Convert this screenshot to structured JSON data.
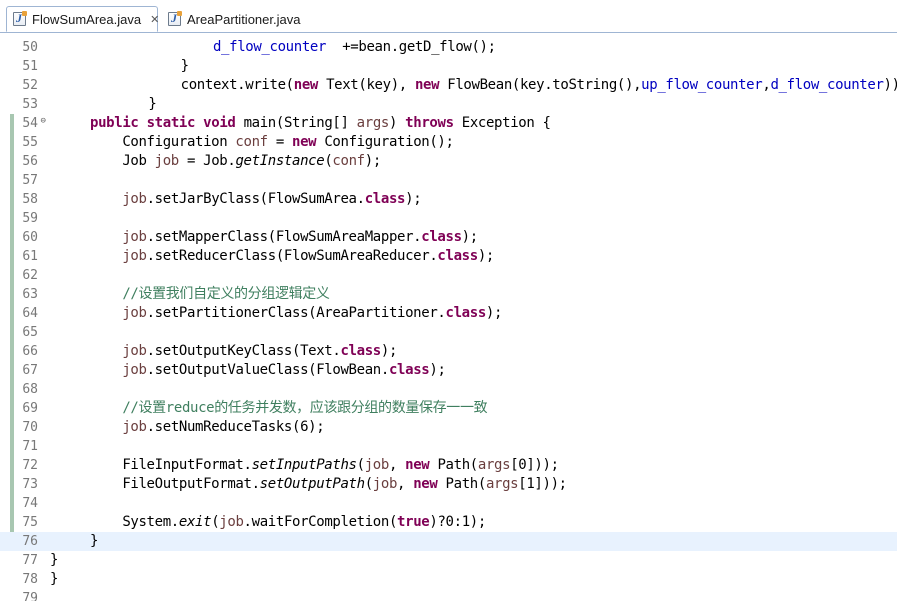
{
  "tabs": [
    {
      "label": "FlowSumArea.java",
      "active": true
    },
    {
      "label": "AreaPartitioner.java",
      "active": false
    }
  ],
  "icons": {
    "file": "java-file-icon",
    "close": "close-icon",
    "fold": "fold-collapse-icon"
  },
  "current_line": "76",
  "lines": [
    {
      "n": "50",
      "tokens": [
        {
          "t": "            "
        },
        {
          "t": "d_flow_counter",
          "c": "fld"
        },
        {
          "t": "  +=bean.getD_flow();"
        }
      ]
    },
    {
      "n": "51",
      "tokens": [
        {
          "t": "        }"
        }
      ]
    },
    {
      "n": "52",
      "tokens": [
        {
          "t": "        context.write("
        },
        {
          "t": "new",
          "c": "kw"
        },
        {
          "t": " Text(key), "
        },
        {
          "t": "new",
          "c": "kw"
        },
        {
          "t": " FlowBean(key.toString(),"
        },
        {
          "t": "up_flow_counter",
          "c": "fld"
        },
        {
          "t": ","
        },
        {
          "t": "d_flow_counter",
          "c": "fld"
        },
        {
          "t": "));"
        }
      ]
    },
    {
      "n": "53",
      "tokens": [
        {
          "t": "    }"
        }
      ]
    },
    {
      "n": "54",
      "fold": true,
      "tokens": [
        {
          "t": "public",
          "c": "kw"
        },
        {
          "t": " "
        },
        {
          "t": "static",
          "c": "kw"
        },
        {
          "t": " "
        },
        {
          "t": "void",
          "c": "kw"
        },
        {
          "t": " main(String[] "
        },
        {
          "t": "args",
          "c": "var"
        },
        {
          "t": ") "
        },
        {
          "t": "throws",
          "c": "kw"
        },
        {
          "t": " Exception {"
        }
      ]
    },
    {
      "n": "55",
      "tokens": [
        {
          "t": "    Configuration "
        },
        {
          "t": "conf",
          "c": "var"
        },
        {
          "t": " = "
        },
        {
          "t": "new",
          "c": "kw"
        },
        {
          "t": " Configuration();"
        }
      ]
    },
    {
      "n": "56",
      "tokens": [
        {
          "t": "    Job "
        },
        {
          "t": "job",
          "c": "var"
        },
        {
          "t": " = Job."
        },
        {
          "t": "getInstance",
          "c": "it"
        },
        {
          "t": "("
        },
        {
          "t": "conf",
          "c": "var"
        },
        {
          "t": ");"
        }
      ]
    },
    {
      "n": "57",
      "tokens": []
    },
    {
      "n": "58",
      "tokens": [
        {
          "t": "    "
        },
        {
          "t": "job",
          "c": "var"
        },
        {
          "t": ".setJarByClass(FlowSumArea."
        },
        {
          "t": "class",
          "c": "kw"
        },
        {
          "t": ");"
        }
      ]
    },
    {
      "n": "59",
      "tokens": []
    },
    {
      "n": "60",
      "tokens": [
        {
          "t": "    "
        },
        {
          "t": "job",
          "c": "var"
        },
        {
          "t": ".setMapperClass(FlowSumAreaMapper."
        },
        {
          "t": "class",
          "c": "kw"
        },
        {
          "t": ");"
        }
      ]
    },
    {
      "n": "61",
      "tokens": [
        {
          "t": "    "
        },
        {
          "t": "job",
          "c": "var"
        },
        {
          "t": ".setReducerClass(FlowSumAreaReducer."
        },
        {
          "t": "class",
          "c": "kw"
        },
        {
          "t": ");"
        }
      ]
    },
    {
      "n": "62",
      "tokens": []
    },
    {
      "n": "63",
      "tokens": [
        {
          "t": "    "
        },
        {
          "t": "//设置我们自定义的分组逻辑定义",
          "c": "cm"
        }
      ]
    },
    {
      "n": "64",
      "tokens": [
        {
          "t": "    "
        },
        {
          "t": "job",
          "c": "var"
        },
        {
          "t": ".setPartitionerClass(AreaPartitioner."
        },
        {
          "t": "class",
          "c": "kw"
        },
        {
          "t": ");"
        }
      ]
    },
    {
      "n": "65",
      "tokens": []
    },
    {
      "n": "66",
      "tokens": [
        {
          "t": "    "
        },
        {
          "t": "job",
          "c": "var"
        },
        {
          "t": ".setOutputKeyClass(Text."
        },
        {
          "t": "class",
          "c": "kw"
        },
        {
          "t": ");"
        }
      ]
    },
    {
      "n": "67",
      "tokens": [
        {
          "t": "    "
        },
        {
          "t": "job",
          "c": "var"
        },
        {
          "t": ".setOutputValueClass(FlowBean."
        },
        {
          "t": "class",
          "c": "kw"
        },
        {
          "t": ");"
        }
      ]
    },
    {
      "n": "68",
      "tokens": []
    },
    {
      "n": "69",
      "tokens": [
        {
          "t": "    "
        },
        {
          "t": "//设置reduce的任务并发数，应该跟分组的数量保存一一致",
          "c": "cm"
        }
      ]
    },
    {
      "n": "70",
      "tokens": [
        {
          "t": "    "
        },
        {
          "t": "job",
          "c": "var"
        },
        {
          "t": ".setNumReduceTasks(6);"
        }
      ]
    },
    {
      "n": "71",
      "tokens": []
    },
    {
      "n": "72",
      "tokens": [
        {
          "t": "    FileInputFormat."
        },
        {
          "t": "setInputPaths",
          "c": "it"
        },
        {
          "t": "("
        },
        {
          "t": "job",
          "c": "var"
        },
        {
          "t": ", "
        },
        {
          "t": "new",
          "c": "kw"
        },
        {
          "t": " Path("
        },
        {
          "t": "args",
          "c": "var"
        },
        {
          "t": "[0]));"
        }
      ]
    },
    {
      "n": "73",
      "tokens": [
        {
          "t": "    FileOutputFormat."
        },
        {
          "t": "setOutputPath",
          "c": "it"
        },
        {
          "t": "("
        },
        {
          "t": "job",
          "c": "var"
        },
        {
          "t": ", "
        },
        {
          "t": "new",
          "c": "kw"
        },
        {
          "t": " Path("
        },
        {
          "t": "args",
          "c": "var"
        },
        {
          "t": "[1]));"
        }
      ]
    },
    {
      "n": "74",
      "tokens": []
    },
    {
      "n": "75",
      "tokens": [
        {
          "t": "    System."
        },
        {
          "t": "exit",
          "c": "it"
        },
        {
          "t": "("
        },
        {
          "t": "job",
          "c": "var"
        },
        {
          "t": ".waitForCompletion("
        },
        {
          "t": "true",
          "c": "kw"
        },
        {
          "t": ")?0:1);"
        }
      ]
    },
    {
      "n": "76",
      "tokens": [
        {
          "t": "}"
        }
      ]
    },
    {
      "n": "77",
      "tokens": [
        {
          "t": "}"
        }
      ]
    },
    {
      "n": "78",
      "tokens": [
        {
          "t": "}"
        }
      ]
    },
    {
      "n": "79",
      "tokens": []
    }
  ]
}
